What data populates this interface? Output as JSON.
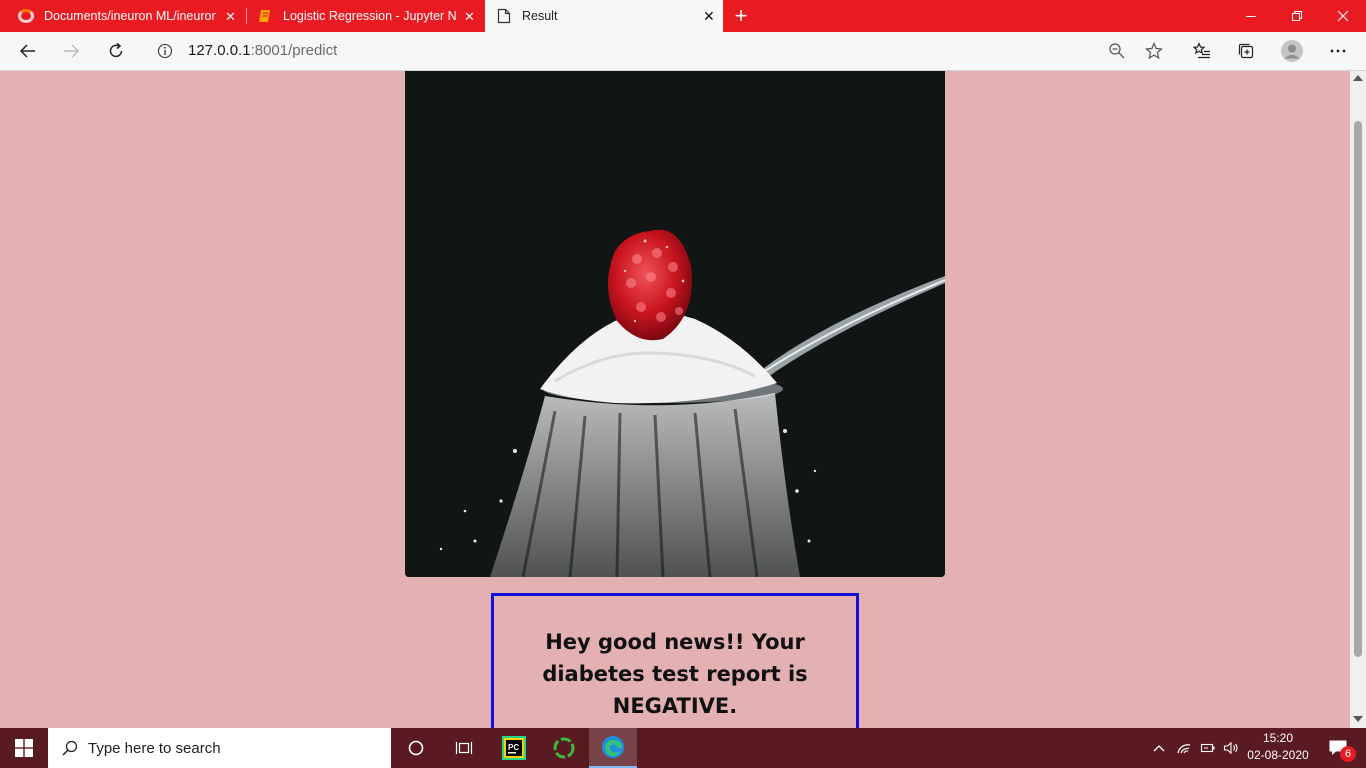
{
  "tabs": [
    {
      "title": "Documents/ineuron ML/ineuron",
      "icon": "opera-ring-icon"
    },
    {
      "title": "Logistic Regression - Jupyter Not",
      "icon": "notebook-icon"
    },
    {
      "title": "Result",
      "icon": "page-icon",
      "active": true
    }
  ],
  "address": {
    "host": "127.0.0.1",
    "rest": ":8001/predict"
  },
  "result": {
    "message": "Hey good news!! Your diabetes test report is NEGATIVE."
  },
  "taskbar": {
    "search_placeholder": "Type here to search",
    "time": "15:20",
    "date": "02-08-2020",
    "notification_count": "6"
  },
  "colors": {
    "tab_bar": "#ea1a22",
    "page_background": "#e3b1b2",
    "result_border": "#1010d8",
    "taskbar": "#5a1a22"
  }
}
